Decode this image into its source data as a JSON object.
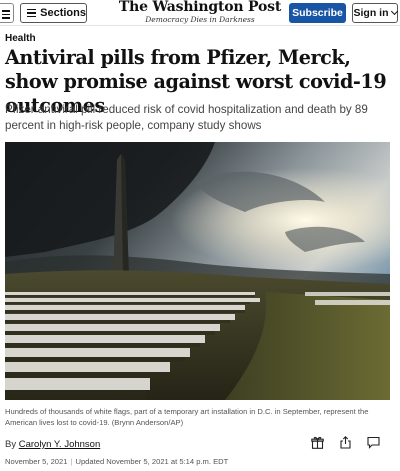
{
  "header": {
    "sections_label": "Sections",
    "logo_text": "The Washington Post",
    "tagline": "Democracy Dies in Darkness",
    "subscribe_label": "Subscribe",
    "signin_label": "Sign in"
  },
  "article": {
    "kicker": "Health",
    "headline": "Antiviral pills from Pfizer, Merck, show promise against worst covid-19 outcomes",
    "subhead": "Pfizer antiviral pill reduced risk of covid hospitalization and death by 89 percent in high-risk people, company study shows",
    "caption": "Hundreds of thousands of white flags, part of a temporary art installation in D.C. in September, represent the American lives lost to covid-19. (Brynn Anderson/AP)",
    "byline_prefix": "By ",
    "author": "Carolyn Y. Johnson",
    "published": "November 5, 2021",
    "separator": "|",
    "updated": "Updated November 5, 2021 at 5:14 p.m. EDT"
  },
  "icons": {
    "gift": "gift-icon",
    "share": "share-icon",
    "comments": "comment-icon"
  },
  "colors": {
    "subscribe": "#1955a5",
    "headline": "#111111"
  }
}
